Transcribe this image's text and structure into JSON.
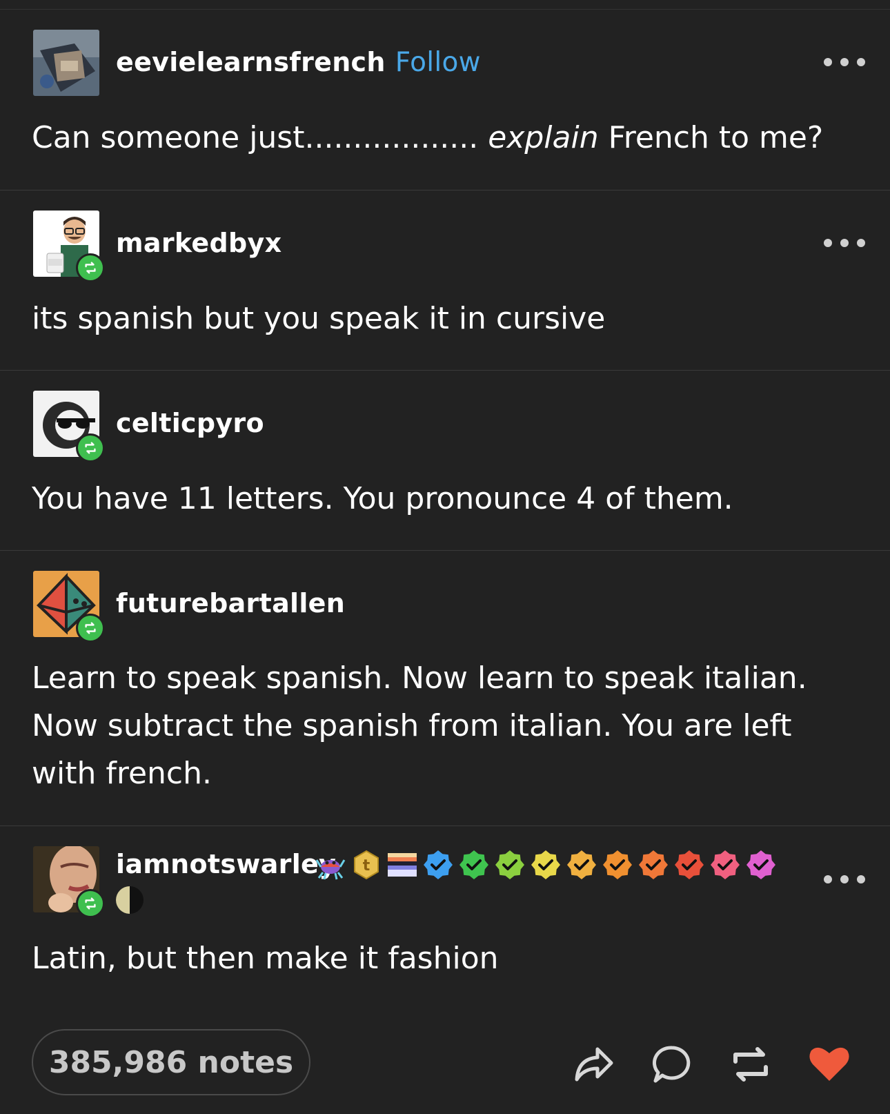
{
  "posts": [
    {
      "username": "eevielearnsfrench",
      "follow_label": "Follow",
      "text_before": "Can someone just..................",
      "text_italic": "explain",
      "text_after": "French to me?"
    },
    {
      "username": "markedbyx",
      "text": "its spanish but you speak it in cursive"
    },
    {
      "username": "celticpyro",
      "text": "You have 11 letters. You pronounce 4 of them."
    },
    {
      "username": "futurebartallen",
      "text": "Learn to speak spanish. Now learn to speak italian. Now subtract the spanish from italian. You are left with french."
    },
    {
      "username": "iamnotswarley",
      "text": "Latin, but then make it fashion"
    }
  ],
  "footer": {
    "notes_label": "385,986 notes"
  },
  "colors": {
    "background": "#222222",
    "follow": "#4aa8e8",
    "reblog_badge": "#3fbf4f",
    "like": "#ef5a3c"
  },
  "verified_badges": [
    "#3d9ff0",
    "#3fc44f",
    "#8bcf3f",
    "#e8d84a",
    "#f0b040",
    "#f09030",
    "#f07838",
    "#e8503a",
    "#f06080",
    "#e060d0"
  ]
}
